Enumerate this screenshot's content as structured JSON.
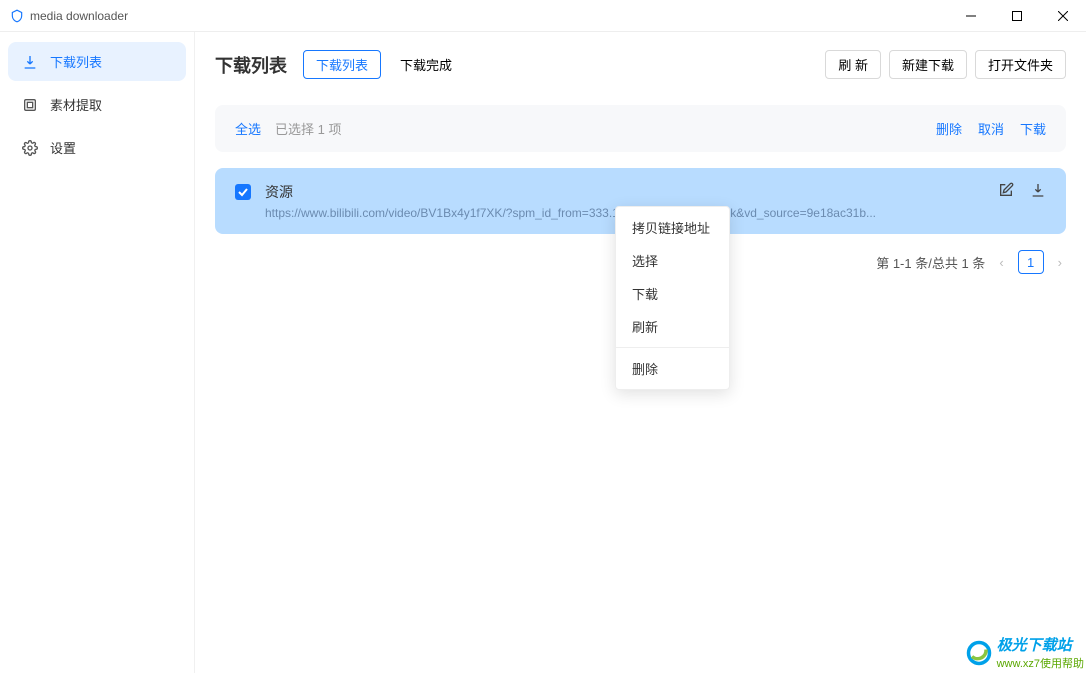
{
  "app": {
    "title": "media downloader"
  },
  "sidebar": {
    "items": [
      {
        "label": "下载列表",
        "icon": "download-icon"
      },
      {
        "label": "素材提取",
        "icon": "extract-icon"
      },
      {
        "label": "设置",
        "icon": "gear-icon"
      }
    ]
  },
  "content": {
    "title": "下载列表",
    "tabs": {
      "list": "下载列表",
      "done": "下载完成"
    },
    "actions": {
      "refresh": "刷 新",
      "new": "新建下载",
      "openFolder": "打开文件夹"
    },
    "selectionBar": {
      "selectAll": "全选",
      "selectedText": "已选择 1 项",
      "delete": "删除",
      "cancel": "取消",
      "download": "下载"
    },
    "items": [
      {
        "title": "资源",
        "url": "https://www.bilibili.com/video/BV1Bx4y1f7XK/?spm_id_from=333.1007.tianma.1-1-1.click&vd_source=9e18ac31b..."
      }
    ],
    "pagination": {
      "text": "第 1-1 条/总共 1 条",
      "current": "1"
    }
  },
  "contextMenu": {
    "copyLink": "拷贝链接地址",
    "select": "选择",
    "download": "下载",
    "refresh": "刷新",
    "delete": "删除"
  },
  "watermark": {
    "brand": "极光下载站",
    "sub": "www.xz7使用帮助"
  }
}
